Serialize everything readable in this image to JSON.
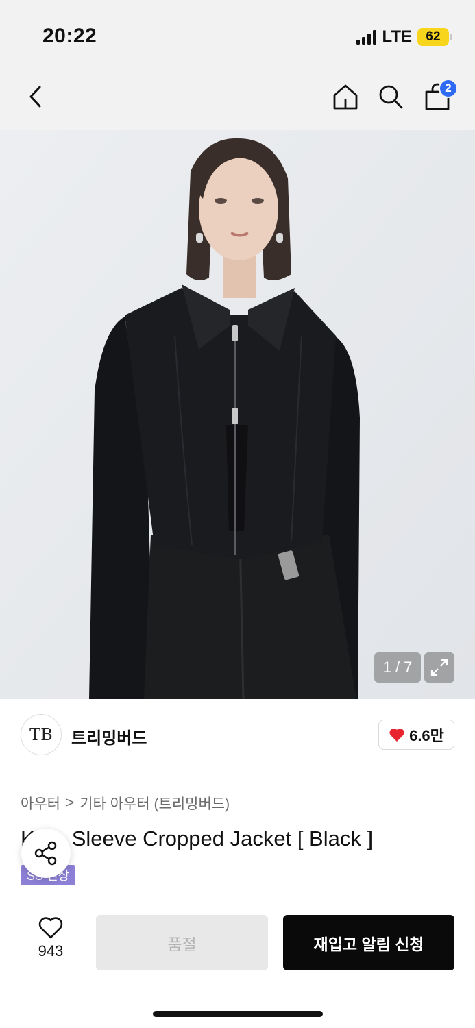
{
  "status_bar": {
    "time": "20:22",
    "network": "LTE",
    "battery": "62",
    "battery_color": "#f7d51c"
  },
  "nav": {
    "icons": [
      "chevron-left-icon",
      "home-icon",
      "search-icon",
      "shopping-bag-icon"
    ],
    "cart_count": "2",
    "badge_color": "#2f6bf2"
  },
  "gallery": {
    "counter": "1 / 7"
  },
  "brand": {
    "logo_text": "TB",
    "name": "트리밍버드",
    "likes": "6.6만"
  },
  "breadcrumb": {
    "level1": "아우터",
    "separator": ">",
    "level2": "기타 아우터 (트리밍버드)"
  },
  "product": {
    "title_visible": "Sleeve Cropped Jacket [ Black ]",
    "title_prefix_partial": "K",
    "badge": "SS 신상",
    "badge_color": "#8b7fd6"
  },
  "bottom_bar": {
    "wish_count": "943",
    "soldout_label": "품절",
    "restock_label": "재입고 알림 신청"
  }
}
